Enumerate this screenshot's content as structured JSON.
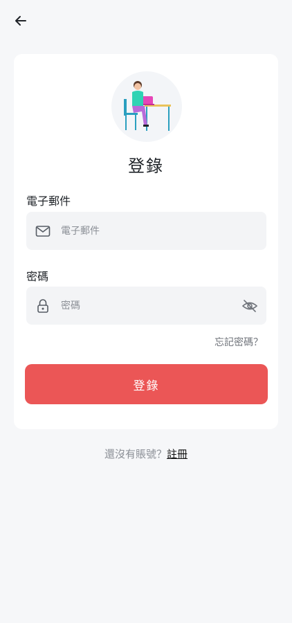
{
  "header": {
    "back_icon": "arrow-left-icon"
  },
  "login": {
    "title": "登錄",
    "email": {
      "label": "電子郵件",
      "placeholder": "電子郵件",
      "value": "",
      "icon": "mail-icon"
    },
    "password": {
      "label": "密碼",
      "placeholder": "密碼",
      "value": "",
      "icon": "lock-icon",
      "toggle_icon": "eye-off-icon"
    },
    "forgot_label": "忘記密碼？",
    "submit_label": "登錄"
  },
  "footer": {
    "question": "還沒有賬號？",
    "register_label": "註冊"
  },
  "colors": {
    "primary": "#eb5656",
    "background": "#f6f7f9",
    "card": "#ffffff",
    "field": "#f3f4f6"
  }
}
